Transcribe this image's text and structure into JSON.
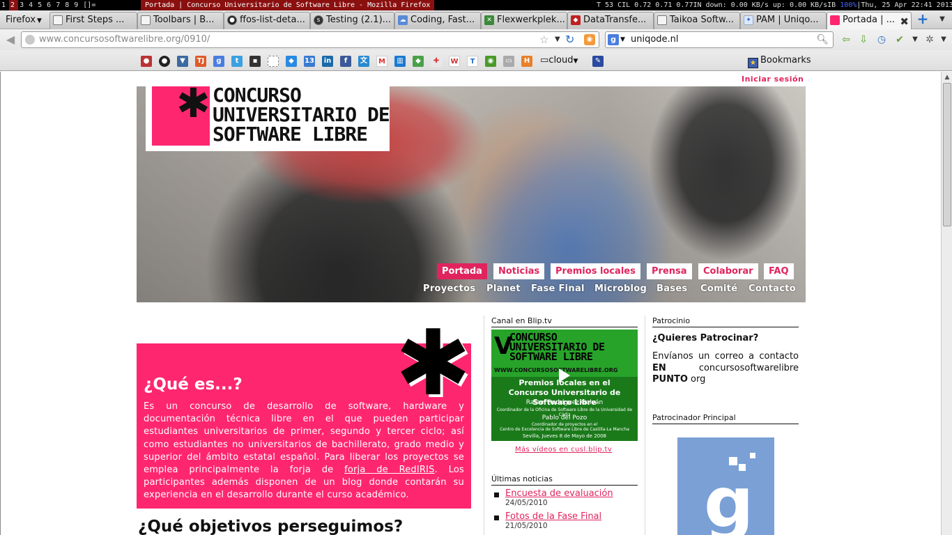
{
  "sysbar": {
    "workspaces": [
      "1",
      "2",
      "3",
      "4",
      "5",
      "6",
      "7",
      "8",
      "9"
    ],
    "layout": "[]=",
    "window_title": "Portada | Concurso Universitario de Software Libre - Mozilla Firefox",
    "stats_a": "T 53 CIL 0.72 0.71 0.77IN down: 0.00 KB/s up: 0.00 KB/sIB ",
    "stats_hl": "100%",
    "stats_b": "|Thu, 25 Apr 22:41 2013"
  },
  "browser": {
    "menu_label": "Firefox",
    "tabs": [
      {
        "label": "First Steps ..."
      },
      {
        "label": "Toolbars | B..."
      },
      {
        "label": "ffos-list-deta..."
      },
      {
        "label": "Testing (2.1)..."
      },
      {
        "label": "Coding, Fast..."
      },
      {
        "label": "Flexwerkplek..."
      },
      {
        "label": "DataTransfe..."
      },
      {
        "label": "Taikoa Softw..."
      },
      {
        "label": "PAM | Uniqo..."
      },
      {
        "label": "Portada | ..."
      }
    ],
    "url_host": "www.concursosoftwarelibre.org",
    "url_path": "/0910/",
    "search_value": "uniqode.nl",
    "bookmark_folder": "cloud",
    "bookmarks_label": "Bookmarks"
  },
  "page": {
    "login": "Iniciar sesión",
    "logo_lines": [
      "CONCURSO",
      "UNIVERSITARIO DE",
      "SOFTWARE LIBRE"
    ],
    "nav_main": [
      "Portada",
      "Noticias",
      "Premios locales",
      "Prensa",
      "Colaborar",
      "FAQ"
    ],
    "nav_sub": [
      "Proyectos",
      "Planet",
      "Fase Final",
      "Microblog",
      "Bases",
      "Comité",
      "Contacto"
    ],
    "que_es": {
      "title": "¿Qué es...?",
      "text_before": "Es un concurso de desarrollo de software, hardware y documentación técnica libre en el que pueden participar estudiantes universitarios de primer, segundo y tercer ciclo; así como estudiantes no universitarios de bachillerato, grado medio y superior del ámbito estatal español. Para liberar los proyectos se emplea principalmente la forja de ",
      "link": "forja de RedIRIS",
      "text_after": ". Los participantes además disponen de un blog donde contarán su experiencia en el desarrollo durante el curso académico."
    },
    "objetivos_title": "¿Qué objetivos perseguimos?",
    "canal": {
      "title": "Canal en Blip.tv",
      "video_logo": [
        "CONCURSO",
        "UNIVERSITARIO DE",
        "SOFTWARE LIBRE"
      ],
      "video_url": "WWW.CONCURSOSOFTWARELIBRE.ORG",
      "video_heading": [
        "Premios locales en el",
        "Concurso Universitario de Software Libre"
      ],
      "speaker1": "Rafael Rodríguez Galván",
      "speaker1_role": "Coordinador de la Oficina de Software Libre de la Universidad de Cádiz",
      "speaker2": "Pablo del Pozo",
      "speaker2_role": [
        "Coordinador de proyectos en el",
        "Centro de Excelencia de Software Libre de Castilla-La Mancha"
      ],
      "video_date": "Sevilla, Jueves 8 de Mayo de 2008",
      "more": "Más vídeos en cusl.blip.tv"
    },
    "news": {
      "title": "Últimas noticias",
      "items": [
        {
          "title": "Encuesta de evaluación",
          "date": "24/05/2010"
        },
        {
          "title": "Fotos de la Fase Final",
          "date": "21/05/2010"
        }
      ]
    },
    "sponsor": {
      "section": "Patrocinio",
      "question": "¿Quieres Patrocinar?",
      "text_a": "Envíanos un correo a contacto ",
      "en": "EN",
      "text_b": " concursosoftwarelibre ",
      "punto": "PUNTO",
      "text_c": " org",
      "main_title": "Patrocinador Principal"
    }
  },
  "colors": {
    "accent": "#e0245e",
    "pink_panel": "#ff2670",
    "video_green": "#1a7a1a"
  }
}
